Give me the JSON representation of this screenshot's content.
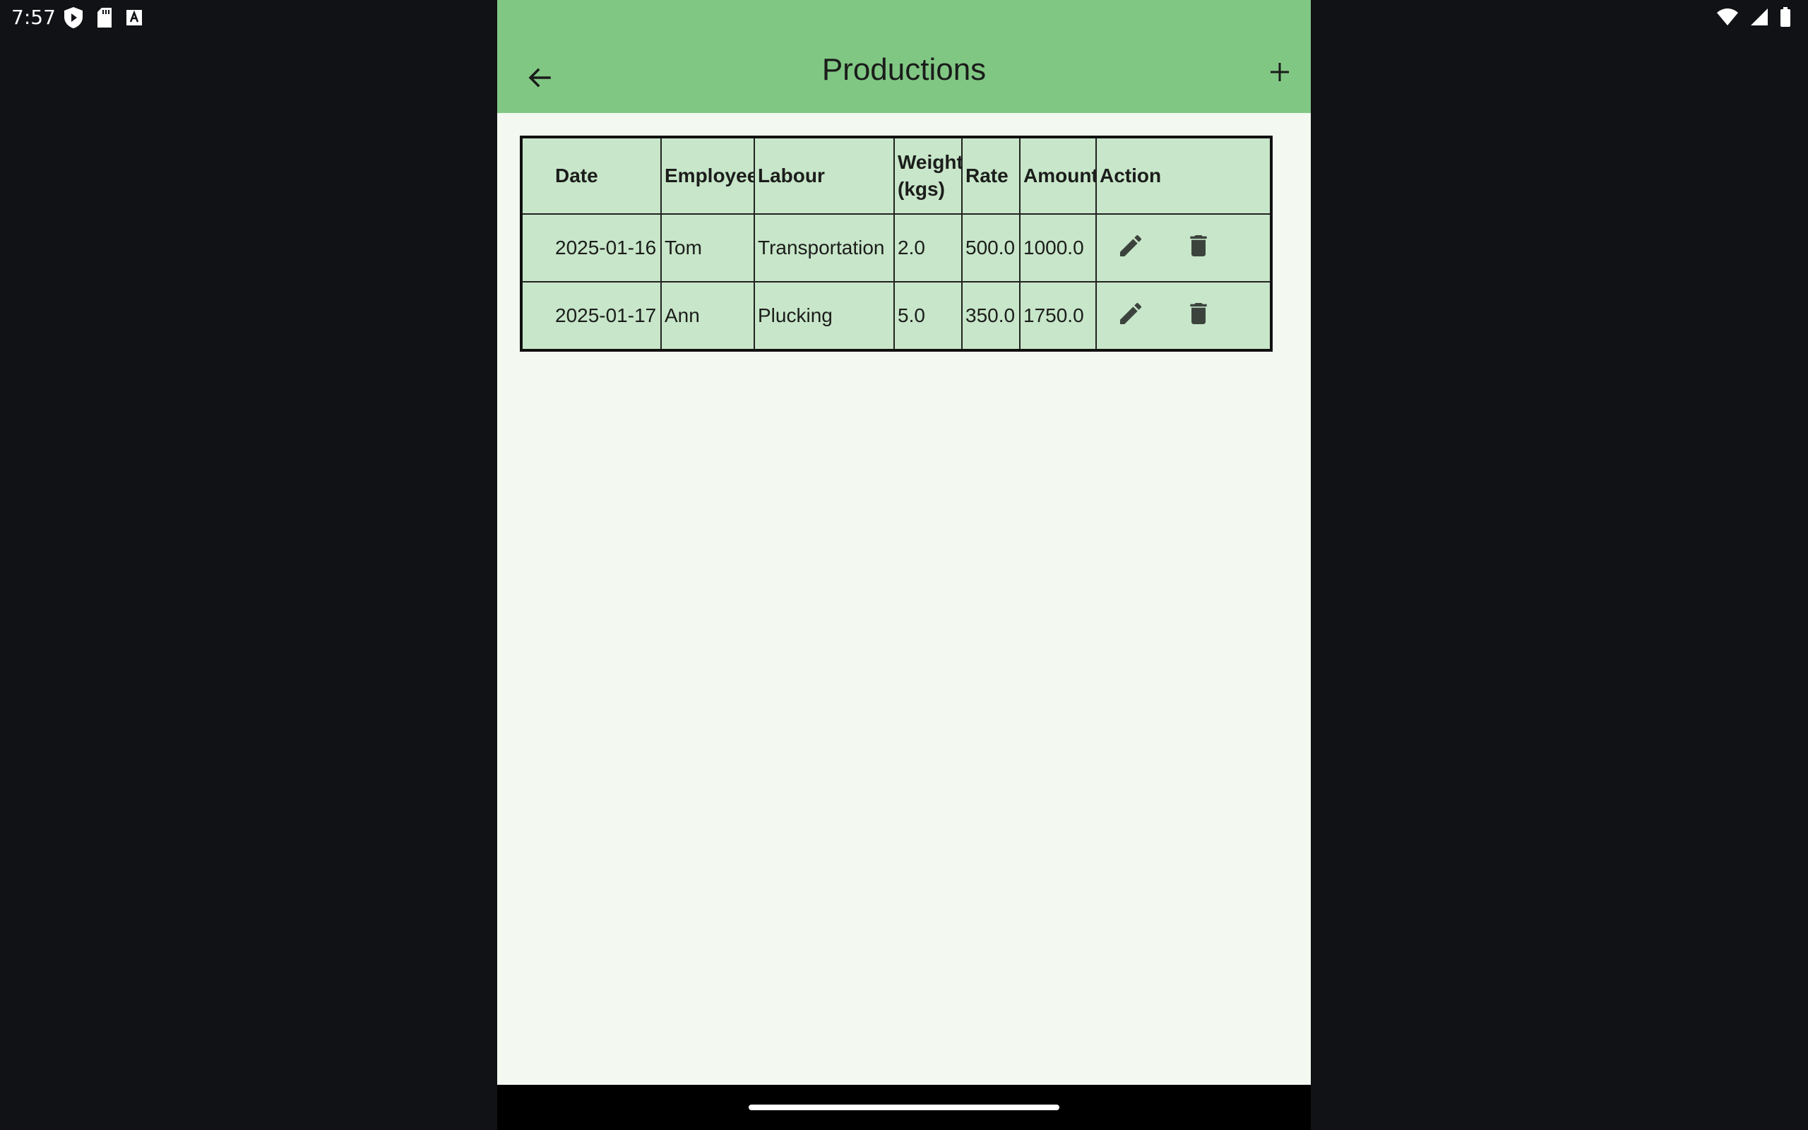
{
  "status_bar": {
    "time": "7:57",
    "left_icons": [
      "shield-play-icon",
      "sd-card-icon",
      "font-a-icon"
    ],
    "right_icons": [
      "wifi-icon",
      "signal-icon",
      "battery-icon"
    ]
  },
  "app_bar": {
    "title": "Productions",
    "back_icon": "arrow-left-icon",
    "add_icon": "plus-icon",
    "color": "#81c784"
  },
  "table": {
    "headers": [
      "Date",
      "Employee",
      "Labour",
      "Weight\n(kgs)",
      "Rate",
      "Amount",
      "Action"
    ],
    "rows": [
      {
        "date": "2025-01-16",
        "employee": "Tom",
        "labour": "Transportation",
        "weight": "2.0",
        "rate": "500.0",
        "amount": "1000.0"
      },
      {
        "date": "2025-01-17",
        "employee": "Ann",
        "labour": "Plucking",
        "weight": "5.0",
        "rate": "350.0",
        "amount": "1750.0"
      }
    ],
    "row_actions": [
      "edit-icon",
      "delete-icon"
    ],
    "background": "#c8e6c9"
  },
  "colors": {
    "app_background": "#f3f9f1",
    "outer_background": "#101216"
  }
}
